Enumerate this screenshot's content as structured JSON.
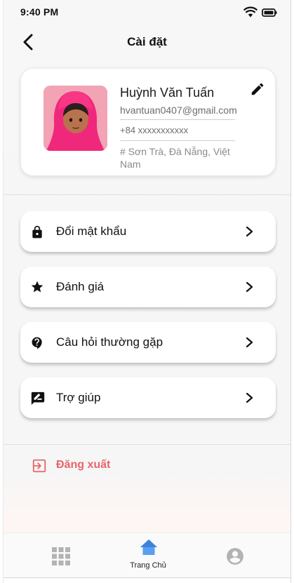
{
  "status_bar": {
    "time": "9:40 PM",
    "wifi_icon": "wifi-icon",
    "battery_icon": "battery-icon"
  },
  "header": {
    "title": "Cài đặt",
    "back_icon": "chevron-left-icon"
  },
  "profile": {
    "name": "Huỳnh Văn Tuấn",
    "email": "hvantuan0407@gmail.com",
    "phone": "+84 xxxxxxxxxxx",
    "address": "# Sơn Trà, Đà Nẵng, Việt Nam",
    "edit_icon": "pencil-icon",
    "avatar_icon": "avatar-girl-hijab"
  },
  "menu": {
    "items": [
      {
        "label": "Đổi mật khẩu",
        "icon": "lock-icon"
      },
      {
        "label": "Đánh giá",
        "icon": "star-icon"
      },
      {
        "label": "Câu hỏi thường gặp",
        "icon": "help-icon"
      },
      {
        "label": "Trợ giúp",
        "icon": "feedback-icon"
      }
    ]
  },
  "logout": {
    "label": "Đăng xuất",
    "icon": "logout-icon",
    "color": "#e8656a"
  },
  "bottom_nav": {
    "items": [
      {
        "icon": "grid-icon",
        "label": ""
      },
      {
        "icon": "home-icon",
        "label": "Trang Chủ"
      },
      {
        "icon": "user-circle-icon",
        "label": ""
      }
    ],
    "active_color": "#4a8fe0"
  }
}
